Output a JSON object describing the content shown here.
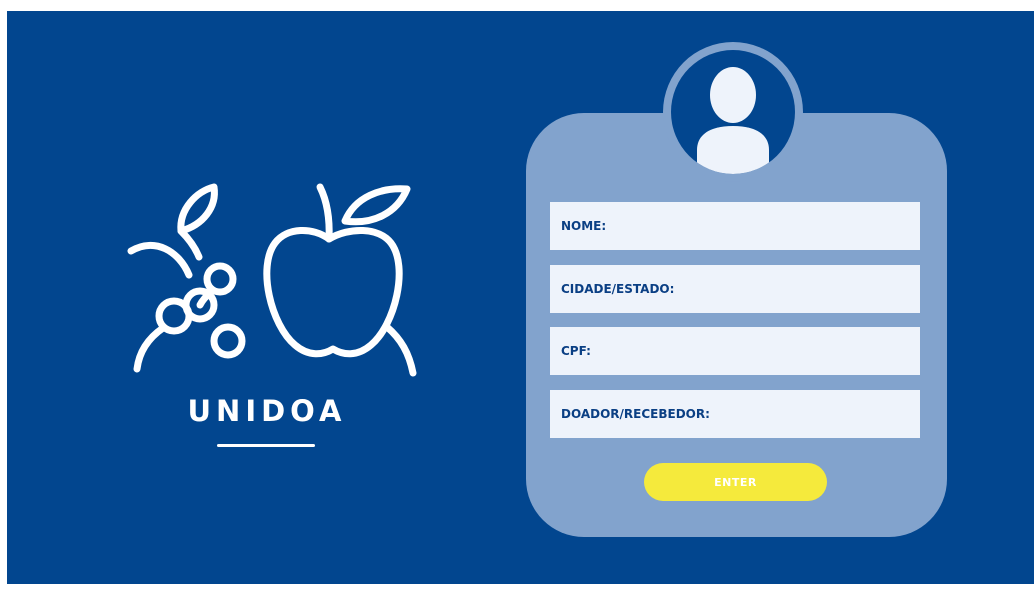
{
  "brand": {
    "name": "UNIDOA"
  },
  "form": {
    "fields": [
      {
        "label": "NOME:",
        "value": ""
      },
      {
        "label": "CIDADE/ESTADO:",
        "value": ""
      },
      {
        "label": "CPF:",
        "value": ""
      },
      {
        "label": "DOADOR/RECEBEDOR:",
        "value": ""
      }
    ],
    "submit_label": "ENTER"
  },
  "icons": {
    "logo": "fruits-logo-icon",
    "avatar": "user-avatar-icon"
  },
  "colors": {
    "background": "#02468f",
    "card": "#82a3cd",
    "field": "#eef3fb",
    "field_text": "#0a3f84",
    "button": "#f5ea3c",
    "button_text": "#ffffff"
  }
}
